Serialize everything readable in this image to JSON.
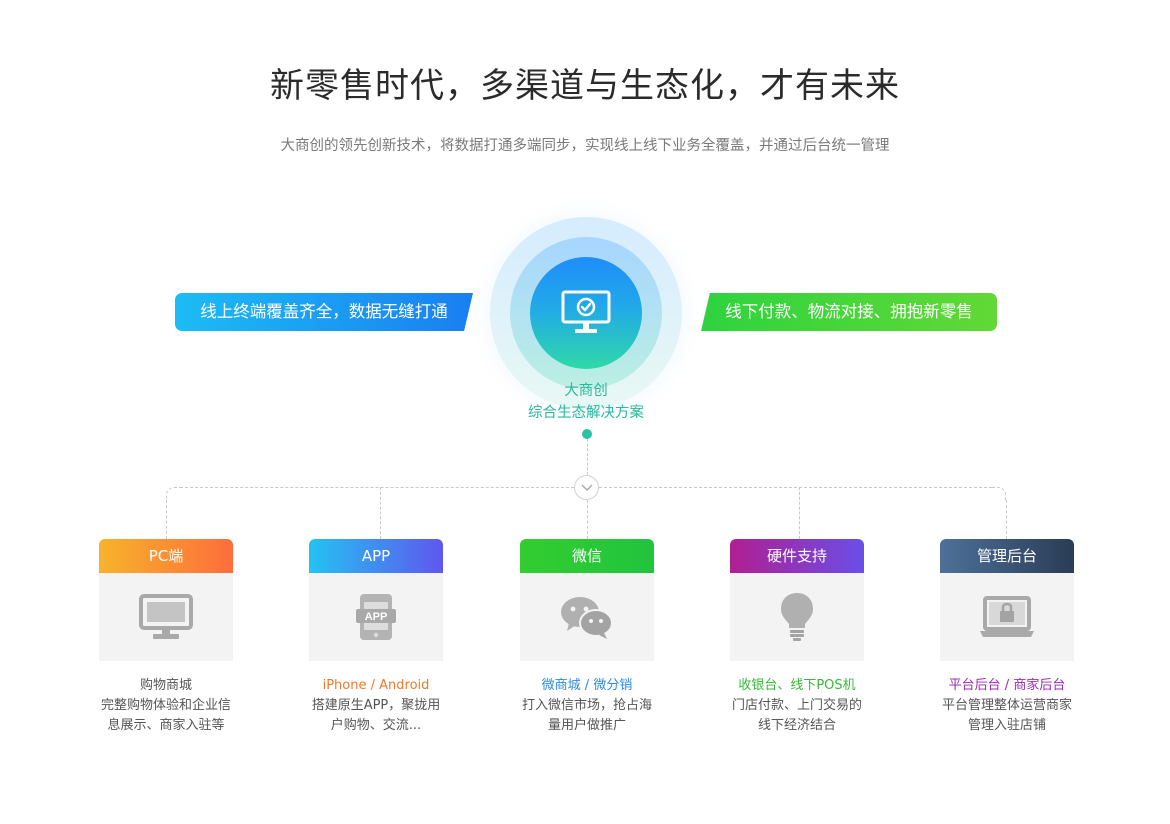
{
  "header": {
    "title": "新零售时代，多渠道与生态化，才有未来",
    "subtitle": "大商创的领先创新技术，将数据打通多端同步，实现线上线下业务全覆盖，并通过后台统一管理"
  },
  "hub": {
    "icon": "monitor-check-icon",
    "line1": "大商创",
    "line2": "综合生态解决方案"
  },
  "banners": {
    "left": "线上终端覆盖齐全，数据无缝打通",
    "right": "线下付款、物流对接、拥抱新零售"
  },
  "cards": [
    {
      "title": "PC端",
      "icon": "desktop-monitor-icon",
      "highlight": "购物商城",
      "highlight_color": "#555555",
      "desc": [
        "完整购物体验和企业信",
        "息展示、商家入驻等"
      ]
    },
    {
      "title": "APP",
      "icon": "mobile-app-icon",
      "highlight": "iPhone / Android",
      "highlight_color": "#f07a2a",
      "desc": [
        "搭建原生APP，聚拢用",
        "户购物、交流..."
      ]
    },
    {
      "title": "微信",
      "icon": "wechat-icon",
      "highlight": "微商城 / 微分销",
      "highlight_color": "#2f8ce0",
      "desc": [
        "打入微信市场，抢占海",
        "量用户做推广"
      ]
    },
    {
      "title": "硬件支持",
      "icon": "lightbulb-icon",
      "highlight": "收银台、线下POS机",
      "highlight_color": "#38b83a",
      "desc": [
        "门店付款、上门交易的",
        "线下经济结合"
      ]
    },
    {
      "title": "管理后台",
      "icon": "laptop-lock-icon",
      "highlight": "平台后台 / 商家后台",
      "highlight_color": "#9a2cb0",
      "desc": [
        "平台管理整体运营商家",
        "管理入驻店铺"
      ]
    }
  ]
}
